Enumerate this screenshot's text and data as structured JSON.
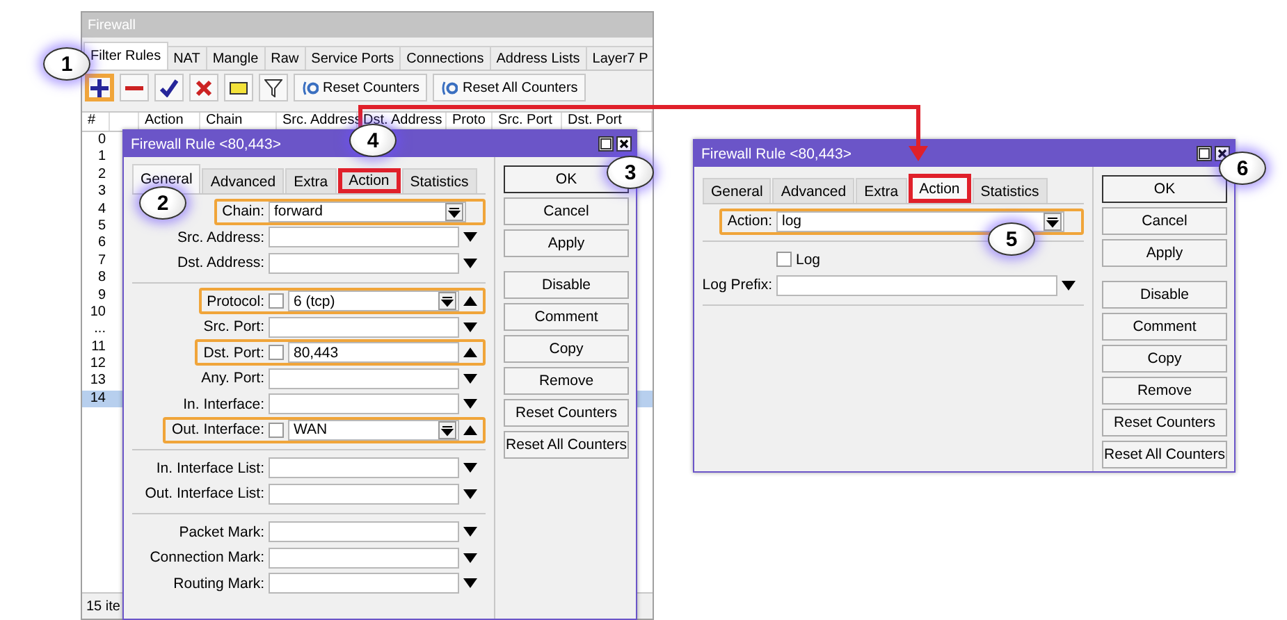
{
  "firewall": {
    "title": "Firewall",
    "tabs": [
      {
        "label": "Filter Rules",
        "selected": true
      },
      {
        "label": "NAT",
        "selected": false
      },
      {
        "label": "Mangle",
        "selected": false
      },
      {
        "label": "Raw",
        "selected": false
      },
      {
        "label": "Service Ports",
        "selected": false
      },
      {
        "label": "Connections",
        "selected": false
      },
      {
        "label": "Address Lists",
        "selected": false
      },
      {
        "label": "Layer7 P",
        "selected": false
      }
    ],
    "toolbar": [
      {
        "kind": "add",
        "highlighted": true
      },
      {
        "kind": "remove",
        "highlighted": false
      },
      {
        "kind": "enable",
        "highlighted": false
      },
      {
        "kind": "disable",
        "highlighted": false
      },
      {
        "kind": "comment",
        "highlighted": false
      },
      {
        "kind": "filter",
        "highlighted": false
      },
      {
        "kind": "reset",
        "label": "Reset Counters",
        "highlighted": false
      },
      {
        "kind": "reset",
        "label": "Reset All Counters",
        "highlighted": false
      }
    ],
    "columns": [
      "#",
      "Action",
      "Chain",
      "Src. Address",
      "Dst. Address",
      "Proto",
      "Src. Port",
      "Dst. Port"
    ],
    "rows": [
      {
        "number": "0",
        "selected": false
      },
      {
        "number": "1",
        "selected": false
      },
      {
        "number": "2",
        "selected": false
      },
      {
        "number": "3",
        "selected": false
      },
      {
        "number": "4",
        "selected": false
      },
      {
        "number": "5",
        "selected": false
      },
      {
        "number": "6",
        "selected": false
      },
      {
        "number": "7",
        "selected": false
      },
      {
        "number": "8",
        "selected": false
      },
      {
        "number": "9",
        "selected": false
      },
      {
        "number": "10",
        "selected": false
      },
      {
        "number": "...",
        "selected": false
      },
      {
        "number": "11",
        "selected": false
      },
      {
        "number": "12",
        "selected": false
      },
      {
        "number": "13",
        "selected": false
      },
      {
        "number": "14",
        "selected": true
      }
    ],
    "status": "15 ite"
  },
  "dialogs": [
    {
      "title": "Firewall Rule <80,443>",
      "tabs": [
        {
          "label": "General",
          "selected": true,
          "highlighted": false
        },
        {
          "label": "Advanced",
          "selected": false,
          "highlighted": false
        },
        {
          "label": "Extra",
          "selected": false,
          "highlighted": false
        },
        {
          "label": "Action",
          "selected": false,
          "highlighted": true
        },
        {
          "label": "Statistics",
          "selected": false,
          "highlighted": false
        }
      ],
      "fields": [
        {
          "kind": "select",
          "label": "Chain:",
          "value": "forward",
          "highlighted": true
        },
        {
          "kind": "optional",
          "label": "Src. Address:",
          "highlighted": false
        },
        {
          "kind": "optional",
          "label": "Dst. Address:",
          "highlighted": false
        },
        {
          "kind": "separator"
        },
        {
          "kind": "toggle-select",
          "label": "Protocol:",
          "value": "6 (tcp)",
          "checked": false,
          "highlighted": true
        },
        {
          "kind": "optional",
          "label": "Src. Port:",
          "highlighted": false
        },
        {
          "kind": "toggle",
          "label": "Dst. Port:",
          "value": "80,443",
          "checked": false,
          "highlighted": true
        },
        {
          "kind": "optional",
          "label": "Any. Port:",
          "highlighted": false
        },
        {
          "kind": "optional",
          "label": "In. Interface:",
          "highlighted": false
        },
        {
          "kind": "toggle-select",
          "label": "Out. Interface:",
          "value": "WAN",
          "checked": false,
          "highlighted": true
        },
        {
          "kind": "separator"
        },
        {
          "kind": "optional",
          "label": "In. Interface List:",
          "highlighted": false
        },
        {
          "kind": "optional",
          "label": "Out. Interface List:",
          "highlighted": false
        },
        {
          "kind": "separator"
        },
        {
          "kind": "optional",
          "label": "Packet Mark:",
          "highlighted": false
        },
        {
          "kind": "optional",
          "label": "Connection Mark:",
          "highlighted": false
        },
        {
          "kind": "optional",
          "label": "Routing Mark:",
          "highlighted": false
        }
      ],
      "buttons": [
        "OK",
        "Cancel",
        "Apply",
        "Disable",
        "Comment",
        "Copy",
        "Remove",
        "Reset Counters",
        "Reset All Counters"
      ]
    },
    {
      "title": "Firewall Rule <80,443>",
      "tabs": [
        {
          "label": "General",
          "selected": false,
          "highlighted": false
        },
        {
          "label": "Advanced",
          "selected": false,
          "highlighted": false
        },
        {
          "label": "Extra",
          "selected": false,
          "highlighted": false
        },
        {
          "label": "Action",
          "selected": true,
          "highlighted": true
        },
        {
          "label": "Statistics",
          "selected": false,
          "highlighted": false
        }
      ],
      "fields": [
        {
          "kind": "select",
          "label": "Action:",
          "value": "log",
          "highlighted": true
        },
        {
          "kind": "separator"
        },
        {
          "kind": "checkbox",
          "label": "Log",
          "checked": false,
          "highlighted": false
        },
        {
          "kind": "optional",
          "label": "Log Prefix:",
          "highlighted": false
        },
        {
          "kind": "separator"
        }
      ],
      "buttons": [
        "OK",
        "Cancel",
        "Apply",
        "Disable",
        "Comment",
        "Copy",
        "Remove",
        "Reset Counters",
        "Reset All Counters"
      ]
    }
  ],
  "callouts": [
    {
      "label": "1"
    },
    {
      "label": "2"
    },
    {
      "label": "3"
    },
    {
      "label": "4"
    },
    {
      "label": "5"
    },
    {
      "label": "6"
    }
  ]
}
